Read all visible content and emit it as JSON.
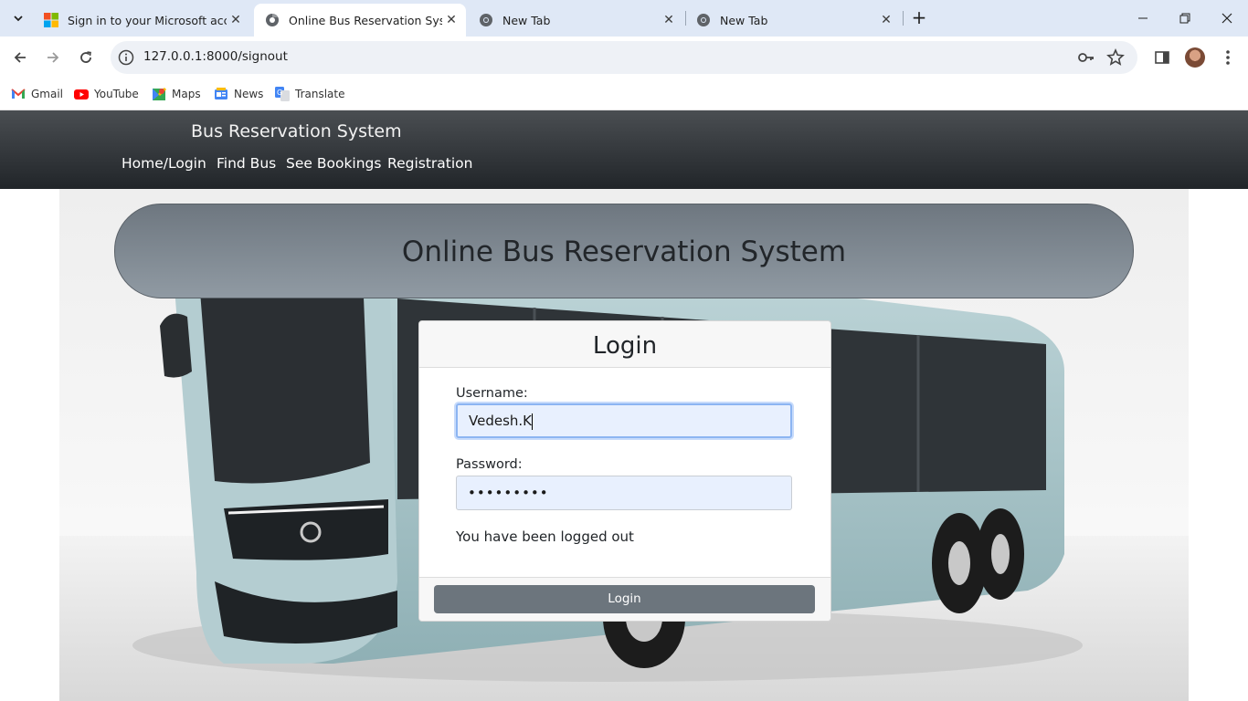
{
  "browser": {
    "tabs": [
      {
        "title": "Sign in to your Microsoft accou",
        "active": false,
        "favicon": "microsoft-icon"
      },
      {
        "title": "Online Bus Reservation System",
        "active": true,
        "favicon": "globe-icon"
      },
      {
        "title": "New Tab",
        "active": false,
        "favicon": "chrome-icon"
      },
      {
        "title": "New Tab",
        "active": false,
        "favicon": "chrome-icon"
      }
    ],
    "url": "127.0.0.1:8000/signout",
    "bookmarks": [
      {
        "label": "Gmail",
        "icon": "gmail-icon"
      },
      {
        "label": "YouTube",
        "icon": "youtube-icon"
      },
      {
        "label": "Maps",
        "icon": "maps-icon"
      },
      {
        "label": "News",
        "icon": "news-icon"
      },
      {
        "label": "Translate",
        "icon": "translate-icon"
      }
    ]
  },
  "site": {
    "brand": "Bus Reservation System",
    "nav": [
      "Home/Login",
      "Find Bus",
      "See Bookings",
      "Registration"
    ],
    "banner_title": "Online Bus Reservation System"
  },
  "login": {
    "title": "Login",
    "username_label": "Username:",
    "username_value": "Vedesh.K",
    "password_label": "Password:",
    "password_masked": "•••••••••",
    "message": "You have been logged out",
    "button": "Login"
  },
  "colors": {
    "navbar": "#212529",
    "banner": "#7f8891",
    "button": "#6c757d",
    "autofill": "#e8f0fe",
    "bus_body": "#a9c4c8"
  }
}
